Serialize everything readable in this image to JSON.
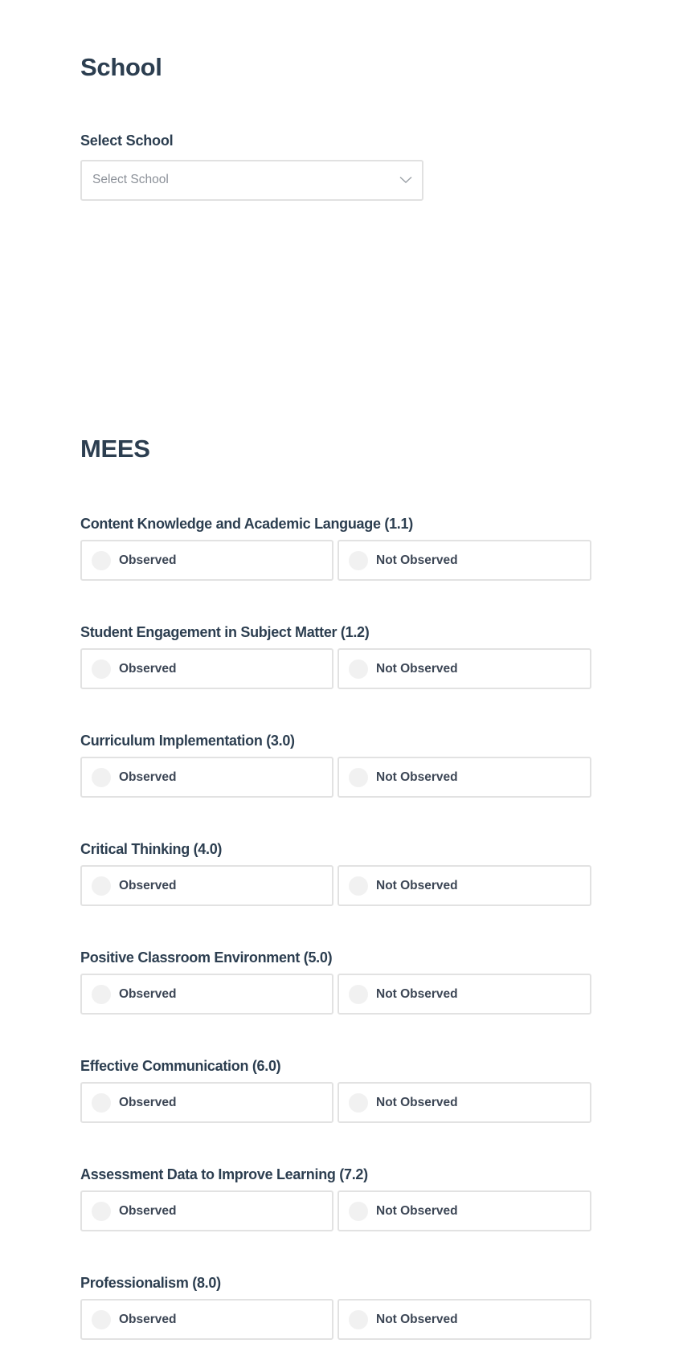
{
  "school_section": {
    "title": "School",
    "select_label": "Select School",
    "select_placeholder": "Select School",
    "select_icon": "chevron-down-icon"
  },
  "mees_section": {
    "title": "MEES",
    "option_labels": {
      "observed": "Observed",
      "not_observed": "Not Observed"
    },
    "questions": [
      {
        "label": "Content Knowledge and Academic Language (1.1)",
        "selected": null
      },
      {
        "label": "Student Engagement in Subject Matter (1.2)",
        "selected": null
      },
      {
        "label": "Curriculum Implementation (3.0)",
        "selected": null
      },
      {
        "label": "Critical Thinking (4.0)",
        "selected": null
      },
      {
        "label": "Positive Classroom Environment (5.0)",
        "selected": null
      },
      {
        "label": "Effective Communication (6.0)",
        "selected": null
      },
      {
        "label": "Assessment Data to Improve Learning (7.2)",
        "selected": null
      },
      {
        "label": "Professionalism (8.0)",
        "selected": null
      }
    ]
  },
  "colors": {
    "heading": "#2c3e50",
    "option_text": "#3c4655",
    "placeholder": "#8b9098",
    "border": "#e2e2e2",
    "radio_fill": "#f1f1f1"
  }
}
